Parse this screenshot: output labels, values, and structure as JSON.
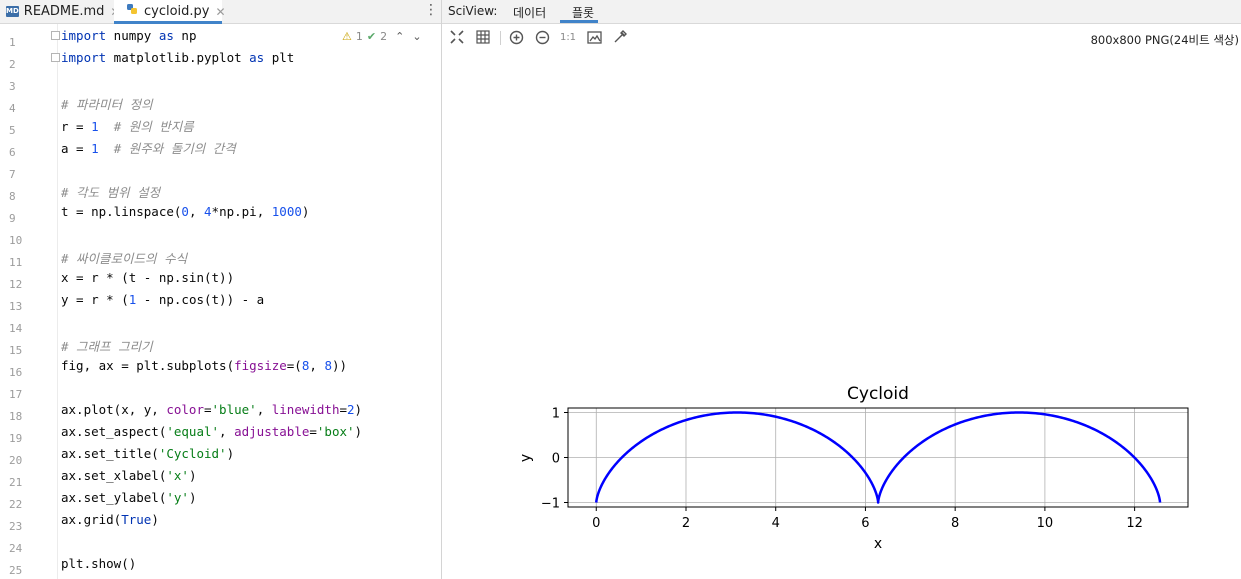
{
  "editor": {
    "tabs": [
      {
        "label": "README.md",
        "icon": "markdown-file-icon",
        "active": false
      },
      {
        "label": "cycloid.py",
        "icon": "python-file-icon",
        "active": true
      }
    ],
    "inspections": {
      "warnings": "1",
      "weak_warnings": "2"
    },
    "line_numbers": [
      "1",
      "2",
      "3",
      "4",
      "5",
      "6",
      "7",
      "8",
      "9",
      "10",
      "11",
      "12",
      "13",
      "14",
      "15",
      "16",
      "17",
      "18",
      "19",
      "20",
      "21",
      "22",
      "23",
      "24",
      "25"
    ],
    "code_lines": [
      "import numpy as np",
      "import matplotlib.pyplot as plt",
      "",
      "# 파라미터 정의",
      "r = 1  # 원의 반지름",
      "a = 1  # 원주와 돌기의 간격",
      "",
      "# 각도 범위 설정",
      "t = np.linspace(0, 4*np.pi, 1000)",
      "",
      "# 싸이클로이드의 수식",
      "x = r * (t - np.sin(t))",
      "y = r * (1 - np.cos(t)) - a",
      "",
      "# 그래프 그리기",
      "fig, ax = plt.subplots(figsize=(8, 8))",
      "",
      "ax.plot(x, y, color='blue', linewidth=2)",
      "ax.set_aspect('equal', adjustable='box')",
      "ax.set_title('Cycloid')",
      "ax.set_xlabel('x')",
      "ax.set_ylabel('y')",
      "ax.grid(True)",
      "",
      "plt.show()"
    ]
  },
  "sciview": {
    "label": "SciView:",
    "tabs": [
      "데이터",
      "플롯"
    ],
    "active_tab": "플롯",
    "toolbar": [
      "fit-icon",
      "grid-icon",
      "zoom-in-icon",
      "zoom-out-icon",
      "actual-size-icon",
      "background-icon",
      "color-picker-icon"
    ],
    "actual_size_label": "1:1",
    "image_info": "800x800 PNG(24비트 색상)"
  },
  "chart_data": {
    "type": "line",
    "title": "Cycloid",
    "xlabel": "x",
    "ylabel": "y",
    "xlim": [
      -0.63,
      13.19
    ],
    "ylim": [
      -1.1,
      1.1
    ],
    "xticks": [
      "0",
      "2",
      "4",
      "6",
      "8",
      "10",
      "12"
    ],
    "yticks": [
      "−1",
      "0",
      "1"
    ],
    "grid": true,
    "series": [
      {
        "color": "#0000ff",
        "function": "x = t - sin(t), y = 1 - cos(t) - 1, t from 0 to 4π",
        "t_range": [
          0,
          12.566
        ]
      }
    ]
  }
}
